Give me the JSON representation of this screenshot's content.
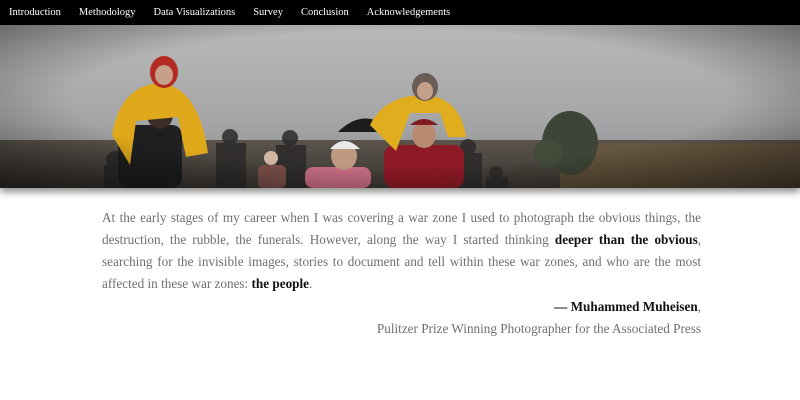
{
  "nav": {
    "items": [
      {
        "label": "Introduction"
      },
      {
        "label": "Methodology"
      },
      {
        "label": "Data Visualizations"
      },
      {
        "label": "Survey"
      },
      {
        "label": "Conclusion"
      },
      {
        "label": "Acknowledgements"
      }
    ]
  },
  "hero": {
    "image": "refugees-walking-in-rain-photo"
  },
  "quote": {
    "part1": "At the early stages of my career when I was covering a war zone I used to photograph the obvious things, the destruction, the rubble, the funerals. However, along the way I started thinking ",
    "emphasis1": "deeper than the obvious",
    "part2": ", searching for the invisible images, stories to document and tell within these war zones, and who are the most affected in these war zones: ",
    "emphasis2": "the people",
    "part3": ".",
    "author": "— Muhammed Muheisen",
    "author_suffix": ",",
    "author_title": "Pulitzer Prize Winning Photographer for the Associated Press"
  },
  "colors": {
    "nav_bg": "#000000",
    "nav_text": "#ffffff",
    "body_text": "#6f6f6f",
    "emphasis_text": "#111111"
  }
}
